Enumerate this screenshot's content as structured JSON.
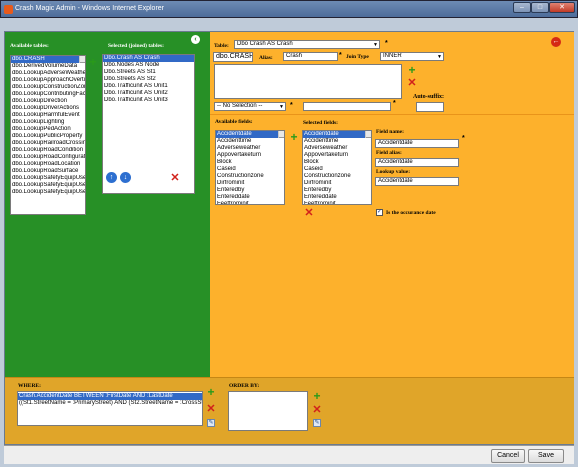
{
  "window": {
    "title": "Crash Magic Admin - Windows Internet Explorer",
    "min": "–",
    "max": "□",
    "close": "✕"
  },
  "left": {
    "available_tables_label": "Available tables:",
    "available_tables": [
      "dbo.CRASH",
      "dbo.DerivedVolumeData",
      "dbo.LookupAdverseWeathe",
      "dbo.LookupApproachOvertu",
      "dbo.LookupConstructionZor",
      "dbo.LookupContributingFact",
      "dbo.LookupDirection",
      "dbo.LookupDriverActions",
      "dbo.LookupHarmfulEvent",
      "dbo.LookupLighting",
      "dbo.LookupPedAction",
      "dbo.LookupPublicProperty",
      "dbo.LookupRailroadCrossing",
      "dbo.LookupRoadCondition",
      "dbo.LookupRoadConfiguration",
      "dbo.LookupRoadLocation",
      "dbo.LookupRoadSurface",
      "dbo.LookupSafetyEquipUse",
      "dbo.LookupSafetyEquipUse",
      "dbo.LookupSafetyEquipUse"
    ],
    "selected_tables_label": "Selected (joined) tables:",
    "selected_tables": [
      "Dbo.Crash AS Crash",
      "Dbo.Nodes AS Node",
      "Dbo.Streets AS St1",
      "Dbo.Streets AS St2",
      "Dbo.Trafficunit AS Unit1",
      "Dbo.Trafficunit AS Unit2",
      "Dbo.Trafficunit AS Unit3"
    ],
    "add_symbol": "+",
    "remove_symbol": "✕",
    "up_symbol": "↑",
    "down_symbol": "↓",
    "collapse_symbol": "‹"
  },
  "right": {
    "table_label": "Table:",
    "table_value": "Dbo Crash AS Crash",
    "table_name": "dbo.CRASH",
    "alias_label": "Alias:",
    "alias_value": "Crash",
    "join_type_label": "Join Type",
    "join_type_value": "INNER",
    "asterisk": "*",
    "no_selection": "-- No Selection --",
    "auto_suffix_label": "Auto-suffix:",
    "available_fields_label": "Available fields:",
    "available_fields": [
      "Accidentdate",
      "Accidenttime",
      "Adverseweather",
      "Appovertaketurn",
      "Block",
      "Caseid",
      "Constructionzone",
      "Dirfrominit",
      "Enteredby",
      "Entereddate",
      "Feetfrominit",
      "Firstharmful"
    ],
    "selected_fields_label": "Selected fields:",
    "selected_fields": [
      "Accidentdate",
      "Accidenttime",
      "Adverseweather",
      "Appovertaketurn",
      "Block",
      "Caseid",
      "Constructionzone",
      "Dirfrominit",
      "Enteredby",
      "Entereddate",
      "Feetfrominit",
      "Firstharmful"
    ],
    "field_name_label": "Field name:",
    "field_name_value": "Accidentdate",
    "field_alias_label": "Field alias:",
    "field_alias_value": "Accidentdate",
    "lookup_value_label": "Lookup value:",
    "lookup_value_value": "Accidentdate",
    "occurance_label": "Is the occurance date",
    "occurance_check": "✓",
    "back_symbol": "←"
  },
  "bottom": {
    "where_label": "WHERE:",
    "where_lines": [
      "Crash.AccidentDate BETWEEN :FirstDate AND :LastDate",
      "((St1.StreetName = :PrimaryStreet) AND (St2.StreetName = :CrossStreet)) OR ((St1"
    ],
    "order_by_label": "ORDER BY:",
    "edit_symbol": "✎"
  },
  "footer": {
    "cancel": "Cancel",
    "save": "Save"
  },
  "colors": {
    "green_panel": "#279026",
    "orange_panel": "#fdb12c",
    "bottom_panel": "#e0a529",
    "selection": "#3169c6"
  }
}
